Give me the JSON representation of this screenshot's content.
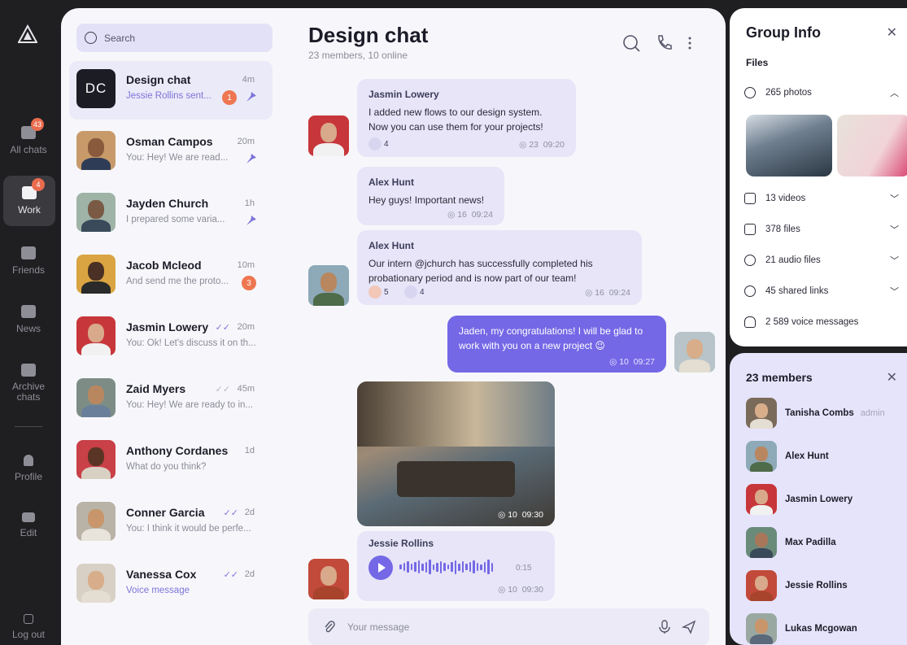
{
  "rail": {
    "items": [
      {
        "label": "All chats",
        "badge": "43"
      },
      {
        "label": "Work",
        "badge": "4"
      },
      {
        "label": "Friends",
        "badge": ""
      },
      {
        "label": "News",
        "badge": ""
      },
      {
        "label": "Archive chats",
        "badge": ""
      },
      {
        "label": "Profile",
        "badge": ""
      },
      {
        "label": "Edit",
        "badge": ""
      },
      {
        "label": "Log out",
        "badge": ""
      }
    ]
  },
  "search": {
    "placeholder": "Search"
  },
  "chats": [
    {
      "initials": "DC",
      "name": "Design chat",
      "time": "4m",
      "preview": "Jessie Rollins sent...",
      "unread": "1",
      "pinned": true
    },
    {
      "name": "Osman Campos",
      "time": "20m",
      "preview": "You: Hey! We are read...",
      "pinned": true
    },
    {
      "name": "Jayden Church",
      "time": "1h",
      "preview": "I prepared some varia...",
      "pinned": true
    },
    {
      "name": "Jacob Mcleod",
      "time": "10m",
      "preview": "And send me the proto...",
      "unread": "3"
    },
    {
      "name": "Jasmin Lowery",
      "time": "20m",
      "preview": "You: Ok! Let's discuss it on th..."
    },
    {
      "name": "Zaid Myers",
      "time": "45m",
      "preview": "You: Hey! We are ready to in..."
    },
    {
      "name": "Anthony Cordanes",
      "time": "1d",
      "preview": "What do you think?"
    },
    {
      "name": "Conner Garcia",
      "time": "2d",
      "preview": "You: I think it would be perfe..."
    },
    {
      "name": "Vanessa Cox",
      "time": "2d",
      "preview": "Voice message"
    }
  ],
  "header": {
    "title": "Design chat",
    "subtitle": "23 members, 10 online"
  },
  "messages": {
    "m1": {
      "author": "Jasmin Lowery",
      "line1": "I added new flows to our design system.",
      "line2": "Now you can use them for your projects!",
      "react": "4",
      "views": "◎ 23",
      "time": "09:20"
    },
    "m2": {
      "author": "Alex Hunt",
      "text": "Hey guys! Important news!",
      "views": "◎ 16",
      "time": "09:24"
    },
    "m3": {
      "author": "Alex Hunt",
      "line1": "Our intern @jchurch has successfully completed his",
      "line2": "probationary period and is now part of our team!",
      "react_fire": "5",
      "react": "4",
      "views": "◎ 16",
      "time": "09:24"
    },
    "m4": {
      "line1": "Jaden, my congratulations! I will be glad to",
      "line2": "work with you on a new project 😉",
      "views": "◎ 10",
      "time": "09:27"
    },
    "photo": {
      "views": "◎ 10",
      "time": "09:30"
    },
    "voice": {
      "author": "Jessie Rollins",
      "duration": "0:15",
      "views": "◎ 10",
      "time": "09:30"
    }
  },
  "composer": {
    "placeholder": "Your message"
  },
  "group_info": {
    "title": "Group Info",
    "files_heading": "Files",
    "rows": [
      {
        "label": "265 photos",
        "chevron": "^"
      },
      {
        "label": "13 videos",
        "chevron": "v"
      },
      {
        "label": "378 files",
        "chevron": "v"
      },
      {
        "label": "21 audio files",
        "chevron": "v"
      },
      {
        "label": "45 shared links",
        "chevron": "v"
      },
      {
        "label": "2 589 voice messages",
        "chevron": ""
      }
    ]
  },
  "members": {
    "title": "23 members",
    "list": [
      {
        "name": "Tanisha Combs",
        "role": "admin"
      },
      {
        "name": "Alex Hunt",
        "role": ""
      },
      {
        "name": "Jasmin Lowery",
        "role": ""
      },
      {
        "name": "Max Padilla",
        "role": ""
      },
      {
        "name": "Jessie Rollins",
        "role": ""
      },
      {
        "name": "Lukas Mcgowan",
        "role": ""
      }
    ]
  },
  "colors": {
    "accent": "#7468e6",
    "badge": "#ee7650",
    "rail": "#1f1f22"
  }
}
